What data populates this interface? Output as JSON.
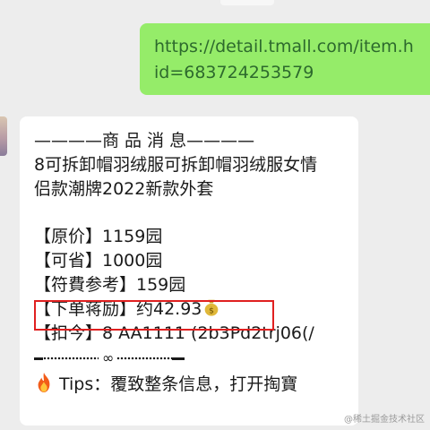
{
  "sent_message": {
    "line1": "https://detail.tmall.com/item.h",
    "line2": "id=683724253579"
  },
  "received_message": {
    "header": "————商 品 消 息————",
    "title_line1": "8可拆卸帽羽绒服可拆卸帽羽绒服女情",
    "title_line2": "侣款潮牌2022新款外套",
    "original_price": "【原价】1159园",
    "savings": "【可省】1000园",
    "reference": "【符費参考】159园",
    "order_reward": "【下单蒋励】约42.93",
    "order_reward_icon": "money-bag",
    "code": "【扣今】8 AA1111 (2b3Pd2trj06(/",
    "divider_symbol": "∞",
    "tips": "Tips：覆致整条信息，打开掏寶",
    "tips_icon": "fire",
    "highlight_color": "#e02020"
  },
  "watermark": "@稀土掘金技术社区",
  "colors": {
    "background": "#ededed",
    "sent_bubble": "#95ec69",
    "received_bubble": "#ffffff"
  }
}
